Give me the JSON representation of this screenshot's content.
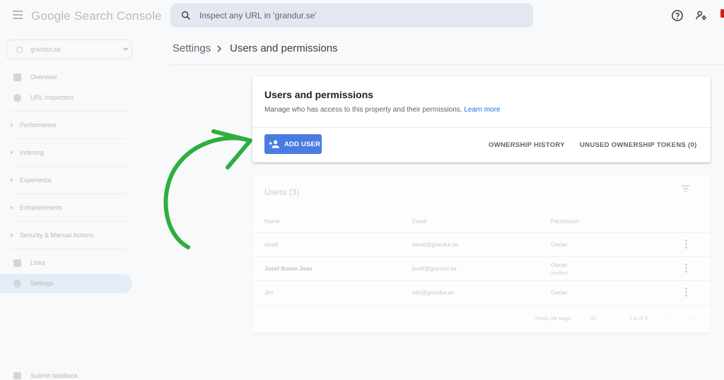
{
  "app": {
    "logo_text": "Google Search Console",
    "search_placeholder": "Inspect any URL in 'grandur.se'"
  },
  "sidebar": {
    "property": "grandur.se",
    "items": [
      {
        "label": "Overview",
        "icon": "home-icon"
      },
      {
        "label": "URL inspection",
        "icon": "search-icon"
      },
      {
        "label": "Performance",
        "icon": "caret-right-icon"
      },
      {
        "label": "Indexing",
        "icon": "caret-right-icon"
      },
      {
        "label": "Experience",
        "icon": "caret-right-icon"
      },
      {
        "label": "Enhancements",
        "icon": "caret-right-icon"
      },
      {
        "label": "Security & Manual Actions",
        "icon": "caret-right-icon"
      },
      {
        "label": "Links",
        "icon": "links-icon"
      },
      {
        "label": "Settings",
        "icon": "settings-icon"
      }
    ],
    "feedback": "Submit feedback"
  },
  "breadcrumb": {
    "parent": "Settings",
    "current": "Users and permissions"
  },
  "card": {
    "title": "Users and permissions",
    "description": "Manage who has access to this property and their permissions.",
    "learn_more": "Learn more",
    "add_user": "ADD USER",
    "ownership_history": "OWNERSHIP HISTORY",
    "unused_tokens": "UNUSED OWNERSHIP TOKENS (0)"
  },
  "users_table": {
    "title": "Users (3)",
    "columns": [
      "Name",
      "Email",
      "Permission"
    ],
    "rows": [
      {
        "name": "david",
        "email": "david@grandur.se",
        "permission": "Owner",
        "sub": ""
      },
      {
        "name": "Josef Bowie-Jean",
        "email": "josef@grandur.se",
        "permission": "Owner",
        "sub": "Verified"
      },
      {
        "name": "Jim",
        "email": "info@grandur.se",
        "permission": "Owner",
        "sub": ""
      }
    ],
    "rows_per_page_label": "Rows per page:",
    "rows_per_page": "10",
    "range": "1-3 of 3"
  },
  "colors": {
    "accent": "#4a7be0",
    "arrow": "#2fae3f",
    "link": "#1a73e8"
  }
}
